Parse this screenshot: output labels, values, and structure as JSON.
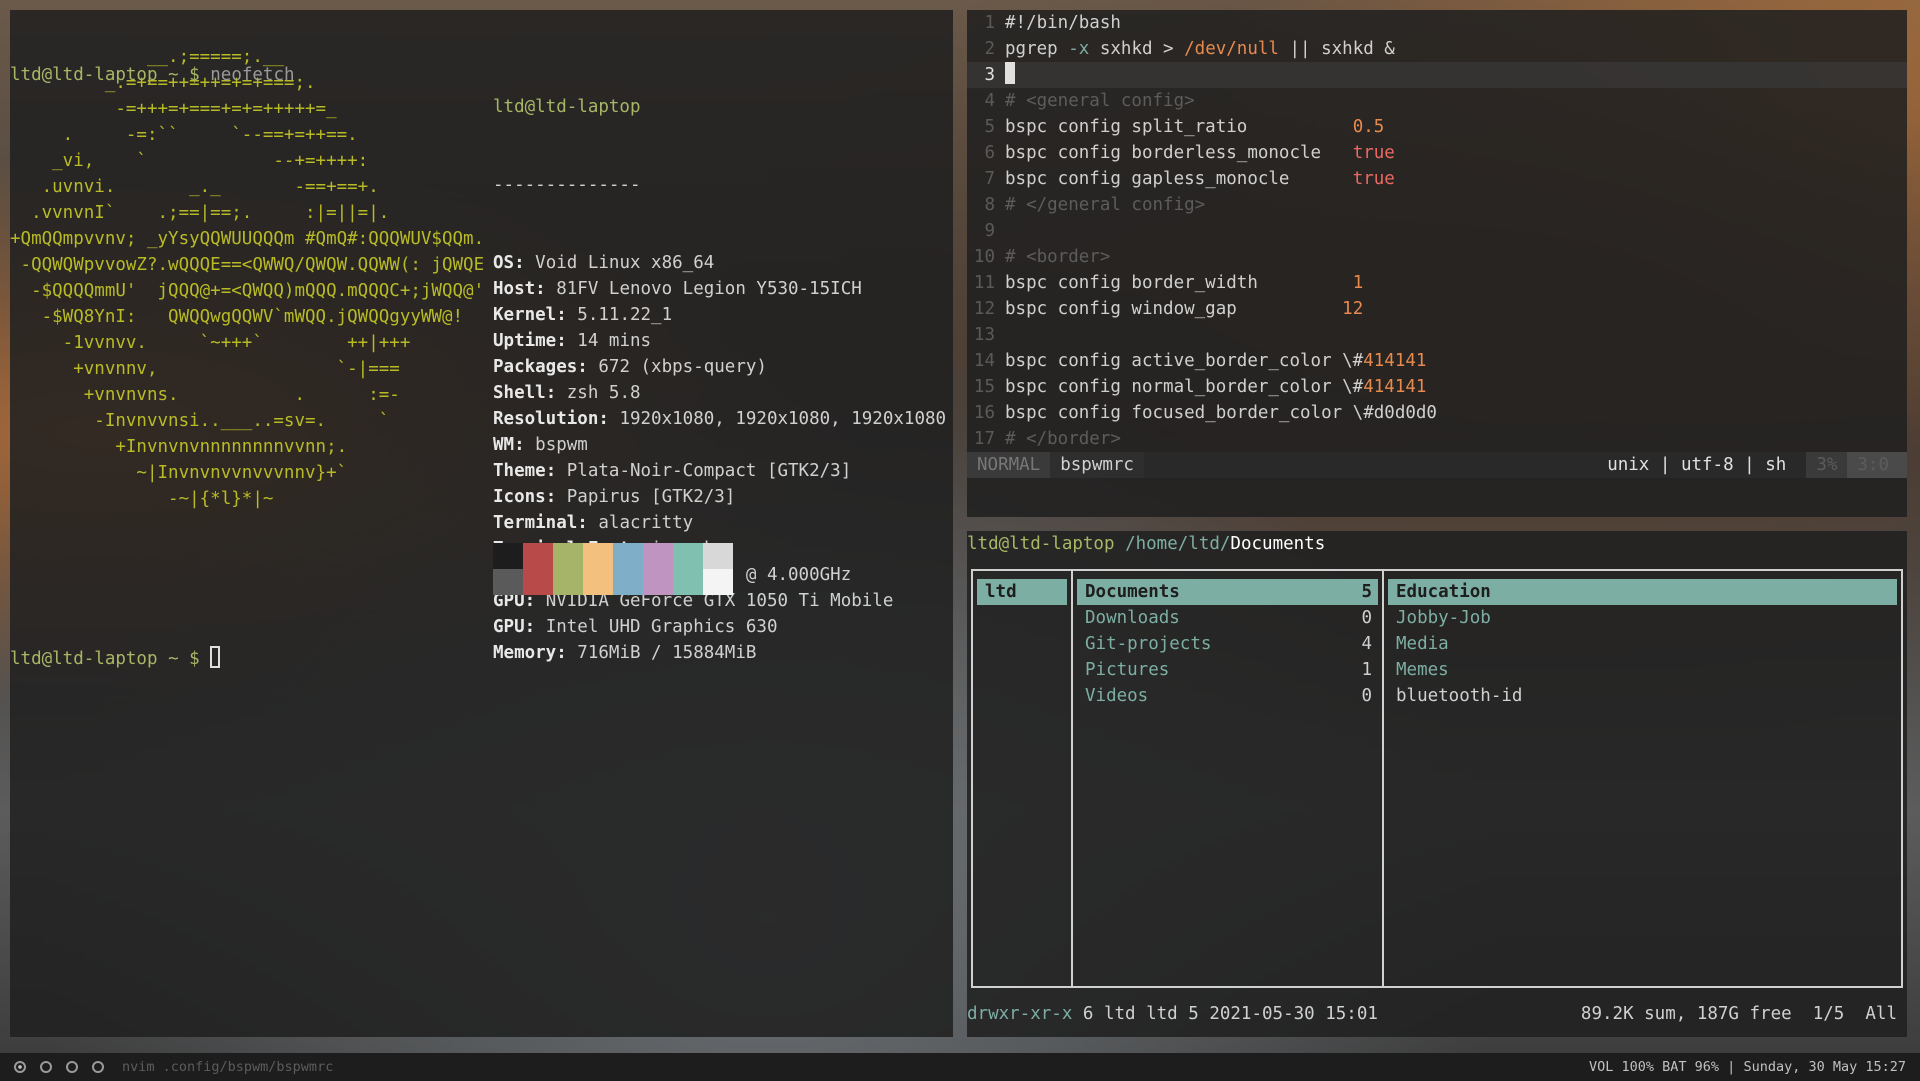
{
  "term_left": {
    "prompt_user": "ltd@ltd-laptop",
    "prompt_tilde": "~",
    "prompt_dollar": "$",
    "command": "neofetch",
    "ascii_art": [
      "             __.;=====;.__",
      "         _.=+==++=++=+=+===;.",
      "          -=+++=+===+=+=+++++=_",
      "     .     -=:``     `--==+=++==.",
      "    _vi,    `            --+=++++:",
      "   .uvnvi.       _._       -==+==+.",
      "  .vvnvnI`    .;==|==;.     :|=||=|.",
      "+QmQQmpvvnv; _yYsyQQWUUQQQm #QmQ#:QQQWUV$QQm.",
      " -QQWQWpvvowZ?.wQQQE==<QWWQ/QWQW.QQWW(: jQWQE",
      "  -$QQQQmmU'  jQQQ@+=<QWQQ)mQQQ.mQQQC+;jWQQ@'",
      "   -$WQ8YnI:   QWQQwgQQWV`mWQQ.jQWQQgyyWW@!",
      "     -1vvnvv.     `~+++`        ++|+++",
      "      +vnvnnv,                 `-|===",
      "       +vnvnvns.           .      :=-",
      "        -Invnvvnsi..___..=sv=.     `",
      "          +Invnvnvnnnnnnnnvvnn;.",
      "            ~|Invnvnvvnvvvnnv}+`",
      "               -~|{*l}*|~"
    ],
    "info_title": "ltd@ltd-laptop",
    "info_sep": "--------------",
    "info": [
      {
        "k": "OS",
        "v": "Void Linux x86_64"
      },
      {
        "k": "Host",
        "v": "81FV Lenovo Legion Y530-15ICH"
      },
      {
        "k": "Kernel",
        "v": "5.11.22_1"
      },
      {
        "k": "Uptime",
        "v": "14 mins"
      },
      {
        "k": "Packages",
        "v": "672 (xbps-query)"
      },
      {
        "k": "Shell",
        "v": "zsh 5.8"
      },
      {
        "k": "Resolution",
        "v": "1920x1080, 1920x1080, 1920x1080"
      },
      {
        "k": "WM",
        "v": "bspwm"
      },
      {
        "k": "Theme",
        "v": "Plata-Noir-Compact [GTK2/3]"
      },
      {
        "k": "Icons",
        "v": "Papirus [GTK2/3]"
      },
      {
        "k": "Terminal",
        "v": "alacritty"
      },
      {
        "k": "Terminal Font",
        "v": "iosevka"
      },
      {
        "k": "CPU",
        "v": "Intel i5-8300H (8) @ 4.000GHz"
      },
      {
        "k": "GPU",
        "v": "NVIDIA GeForce GTX 1050 Ti Mobile"
      },
      {
        "k": "GPU",
        "v": "Intel UHD Graphics 630"
      },
      {
        "k": "Memory",
        "v": "716MiB / 15884MiB"
      }
    ],
    "palette_top": [
      "#1d1d1d",
      "#b84a4a",
      "#a6b46a",
      "#f3c07e",
      "#7eaec8",
      "#c094c0",
      "#7fc0b0",
      "#d8d8d8"
    ],
    "palette_bottom": [
      "#5a5a5a",
      "#b84a4a",
      "#a6b46a",
      "#f3c07e",
      "#7eaec8",
      "#c094c0",
      "#7fc0b0",
      "#f4f4f4"
    ]
  },
  "nvim": {
    "lines": [
      {
        "n": "1",
        "parts": [
          [
            "txt",
            "#!/bin/bash"
          ]
        ]
      },
      {
        "n": "2",
        "parts": [
          [
            "txt",
            "pgrep "
          ],
          [
            "kw",
            "-x"
          ],
          [
            "txt",
            " sxhkd > "
          ],
          [
            "path",
            "/dev/null"
          ],
          [
            "txt",
            " || sxhkd &"
          ]
        ]
      },
      {
        "n": "3",
        "parts": [],
        "current": true
      },
      {
        "n": "4",
        "parts": [
          [
            "comment",
            "# <general config>"
          ]
        ]
      },
      {
        "n": "5",
        "parts": [
          [
            "txt",
            "bspc config split_ratio          "
          ],
          [
            "num",
            "0.5"
          ]
        ]
      },
      {
        "n": "6",
        "parts": [
          [
            "txt",
            "bspc config borderless_monocle   "
          ],
          [
            "bool",
            "true"
          ]
        ]
      },
      {
        "n": "7",
        "parts": [
          [
            "txt",
            "bspc config gapless_monocle      "
          ],
          [
            "bool",
            "true"
          ]
        ]
      },
      {
        "n": "8",
        "parts": [
          [
            "comment",
            "# </general config>"
          ]
        ]
      },
      {
        "n": "9",
        "parts": []
      },
      {
        "n": "10",
        "parts": [
          [
            "comment",
            "# <border>"
          ]
        ]
      },
      {
        "n": "11",
        "parts": [
          [
            "txt",
            "bspc config border_width         "
          ],
          [
            "num",
            "1"
          ]
        ]
      },
      {
        "n": "12",
        "parts": [
          [
            "txt",
            "bspc config window_gap          "
          ],
          [
            "num",
            "12"
          ]
        ]
      },
      {
        "n": "13",
        "parts": []
      },
      {
        "n": "14",
        "parts": [
          [
            "txt",
            "bspc config active_border_color \\#"
          ],
          [
            "num",
            "414141"
          ]
        ]
      },
      {
        "n": "15",
        "parts": [
          [
            "txt",
            "bspc config normal_border_color \\#"
          ],
          [
            "num",
            "414141"
          ]
        ]
      },
      {
        "n": "16",
        "parts": [
          [
            "txt",
            "bspc config focused_border_color \\#d0d0d0"
          ]
        ]
      },
      {
        "n": "17",
        "parts": [
          [
            "comment",
            "# </border>"
          ]
        ]
      }
    ],
    "status": {
      "mode": "NORMAL",
      "file": "bspwmrc",
      "enc": "unix | utf-8 | sh",
      "pct": "3%",
      "pos": "3:0"
    }
  },
  "ranger": {
    "user": "ltd@ltd-laptop",
    "path": "/home/ltd/",
    "dir": "Documents",
    "col1": [
      {
        "name": "ltd",
        "sel": true
      }
    ],
    "col2": [
      {
        "name": "Documents",
        "count": "5",
        "sel": true
      },
      {
        "name": "Downloads",
        "count": "0"
      },
      {
        "name": "Git-projects",
        "count": "4"
      },
      {
        "name": "Pictures",
        "count": "1"
      },
      {
        "name": "Videos",
        "count": "0"
      }
    ],
    "col3": [
      {
        "name": "Education",
        "sel": true
      },
      {
        "name": "Jobby-Job"
      },
      {
        "name": "Media"
      },
      {
        "name": "Memes"
      },
      {
        "name": "bluetooth-id",
        "file": true
      }
    ],
    "footer_perm": "drwxr-xr-x",
    "footer_meta": " 6 ltd ltd 5 2021-05-30 15:01",
    "footer_right": "89.2K sum, 187G free  1/5  All"
  },
  "bar": {
    "workspaces": 4,
    "title": "nvim .config/bspwm/bspwmrc",
    "right": "VOL 100%  BAT 96% | Sunday, 30 May 15:27"
  }
}
